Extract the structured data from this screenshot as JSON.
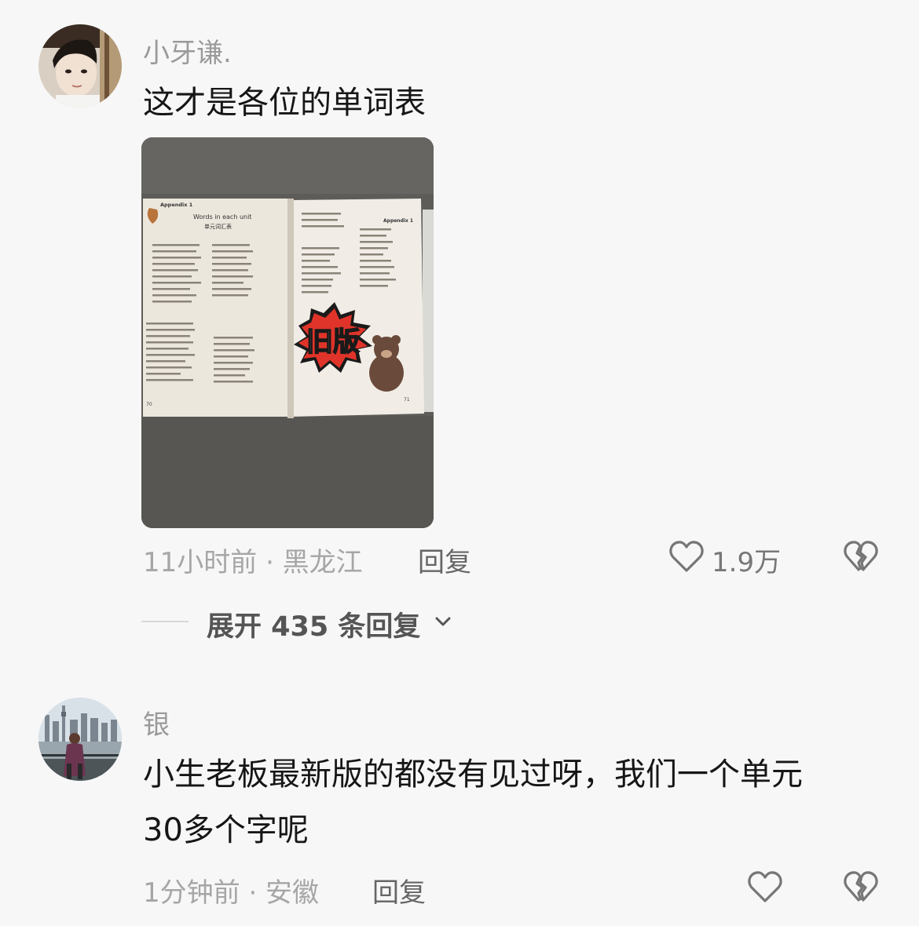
{
  "comments": [
    {
      "author": "小牙谦.",
      "text": "这才是各位的单词表",
      "time_location": "11小时前 · 黑龙江",
      "reply_label": "回复",
      "likes": "1.9万",
      "image": {
        "left_page": {
          "header": "Appendix 1",
          "title": "Words in each unit",
          "subtitle": "单元词汇表",
          "page_no": "70"
        },
        "right_page": {
          "header": "Appendix 1",
          "page_no": "71"
        },
        "sticker_text": "旧版"
      },
      "expand_label": "展开 435 条回复"
    },
    {
      "author": "银",
      "text_line1": "小生老板最新版的都没有见过呀，我们一个单元",
      "text_line2": "30多个字呢",
      "time_location": "1分钟前 · 安徽",
      "reply_label": "回复"
    }
  ],
  "icons": {
    "like": "heart-outline-icon",
    "dislike": "broken-heart-icon",
    "expand": "chevron-down-icon"
  },
  "colors": {
    "background": "#f7f7f7",
    "text": "#161616",
    "meta": "#a6a6a6",
    "sticker_red": "#e0342a"
  }
}
